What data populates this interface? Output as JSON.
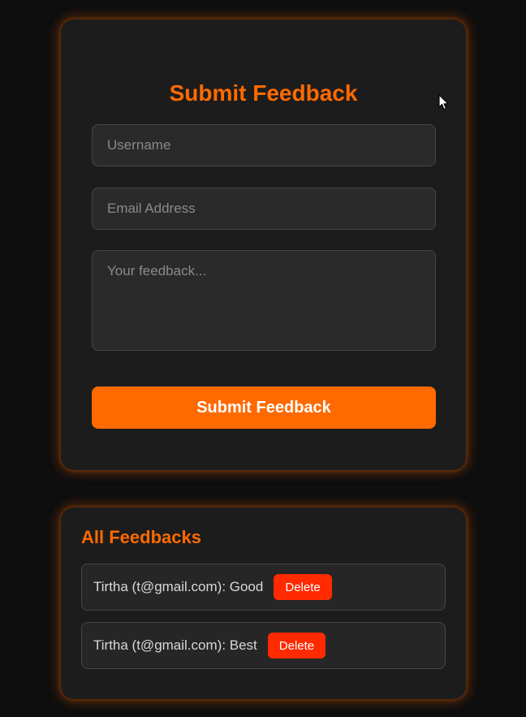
{
  "form": {
    "title": "Submit Feedback",
    "username_placeholder": "Username",
    "username_value": "",
    "email_placeholder": "Email Address",
    "email_value": "",
    "feedback_placeholder": "Your feedback...",
    "feedback_value": "",
    "submit_label": "Submit Feedback"
  },
  "feedbacks": {
    "title": "All Feedbacks",
    "items": [
      {
        "text": "Tirtha (t@gmail.com): Good",
        "delete_label": "Delete"
      },
      {
        "text": "Tirtha (t@gmail.com): Best",
        "delete_label": "Delete"
      }
    ]
  },
  "colors": {
    "accent": "#ff6a00",
    "delete": "#ff2a00",
    "background": "#0e0e0e",
    "card": "#1c1c1c"
  },
  "icons": {
    "cursor": "mouse-pointer-icon"
  }
}
